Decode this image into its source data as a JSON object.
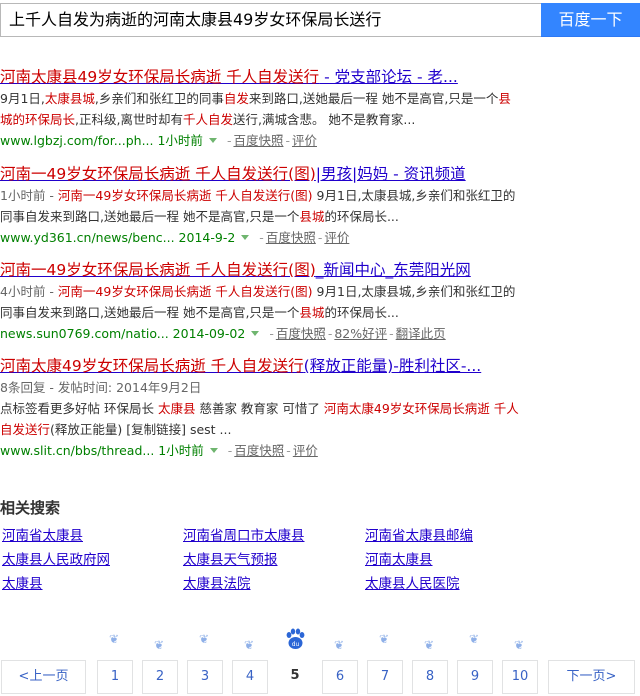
{
  "search": {
    "query": "上千人自发为病逝的河南太康县49岁女环保局长送行",
    "button_label": "百度一下"
  },
  "results": [
    {
      "title_parts": [
        {
          "t": "河南太康县49岁女环保局长病逝 千人自发送行",
          "hl": true
        },
        {
          "t": " - 党支部论坛 - 老...",
          "hl": false
        }
      ],
      "abstract_lines": [
        [
          {
            "t": "9月1日,"
          },
          {
            "t": "太康县城",
            "hl": true
          },
          {
            "t": ",乡亲们和张红卫的同事"
          },
          {
            "t": "自发",
            "hl": true
          },
          {
            "t": "来到路口,送她最后一程 她不是高官,只是一个"
          },
          {
            "t": "县",
            "hl": true
          }
        ],
        [
          {
            "t": "城的环保局长",
            "hl": true
          },
          {
            "t": ",正科级,离世时却有"
          },
          {
            "t": "千人自发",
            "hl": true
          },
          {
            "t": "送行,满城含悲。 她不是教育家..."
          }
        ]
      ],
      "url": "www.lgbzj.com/for...ph...",
      "time": "1小时前",
      "links": [
        "百度快照",
        "评价"
      ]
    },
    {
      "title_parts": [
        {
          "t": "河南一49岁女环保局长病逝 千人自发送行(图)",
          "hl": true
        },
        {
          "t": "|男孩|妈妈 - 资讯频道",
          "hl": false
        }
      ],
      "abstract_lines": [
        [
          {
            "t": "1小时前 - ",
            "gray": true
          },
          {
            "t": "河南一49岁女环保局长病逝 千人自发送行(图)",
            "hl": true
          },
          {
            "t": " 9月1日,太康县城,乡亲们和张红卫的"
          }
        ],
        [
          {
            "t": "同事自发来到路口,送她最后一程 她不是高官,只是一个"
          },
          {
            "t": "县城",
            "hl": true
          },
          {
            "t": "的环保局长..."
          }
        ]
      ],
      "url": "www.yd361.cn/news/benc...",
      "time": "2014-9-2",
      "links": [
        "百度快照",
        "评价"
      ]
    },
    {
      "title_parts": [
        {
          "t": "河南一49岁女环保局长病逝 千人自发送行(图)",
          "hl": true
        },
        {
          "t": "_新闻中心_东莞阳光网",
          "hl": false
        }
      ],
      "abstract_lines": [
        [
          {
            "t": "4小时前 - ",
            "gray": true
          },
          {
            "t": "河南一49岁女环保局长病逝 千人自发送行(图)",
            "hl": true
          },
          {
            "t": " 9月1日,太康县城,乡亲们和张红卫的"
          }
        ],
        [
          {
            "t": "同事自发来到路口,送她最后一程 她不是高官,只是一个"
          },
          {
            "t": "县城",
            "hl": true
          },
          {
            "t": "的环保局长..."
          }
        ]
      ],
      "url": "news.sun0769.com/natio...",
      "time": "2014-09-02",
      "links": [
        "百度快照",
        "82%好评",
        "翻译此页"
      ]
    },
    {
      "title_parts": [
        {
          "t": "河南太康49岁女环保局长病逝 千人自发送行",
          "hl": true
        },
        {
          "t": "(释放正能量)-胜利社区-...",
          "hl": false
        }
      ],
      "abstract_lines": [
        [
          {
            "t": "8条回复 - 发帖时间: 2014年9月2日",
            "gray": true
          }
        ],
        [
          {
            "t": "点标签看更多好帖 环保局长 "
          },
          {
            "t": "太康县",
            "hl": true
          },
          {
            "t": " 慈善家 教育家 可惜了 "
          },
          {
            "t": "河南太康49岁女环保局长病逝 千人",
            "hl": true
          }
        ],
        [
          {
            "t": "自发送行",
            "hl": true
          },
          {
            "t": "(释放正能量) [复制链接] sest ..."
          }
        ]
      ],
      "url": "www.slit.cn/bbs/thread...",
      "time": "1小时前",
      "links": [
        "百度快照",
        "评价"
      ]
    }
  ],
  "related": {
    "title": "相关搜索",
    "items": [
      "河南省太康县",
      "河南省周口市太康县",
      "河南省太康县邮编",
      "太康县人民政府网",
      "太康县天气预报",
      "河南太康县",
      "太康县",
      "太康县法院",
      "太康县人民医院"
    ]
  },
  "pager": {
    "prev": "<上一页",
    "pages": [
      "1",
      "2",
      "3",
      "4",
      "5",
      "6",
      "7",
      "8",
      "9",
      "10"
    ],
    "current": "5",
    "next": "下一页>",
    "paw_label": "du"
  },
  "colors": {
    "link": "#2000cc",
    "highlight": "#cc0000",
    "url": "#008000",
    "button": "#3385ff"
  }
}
